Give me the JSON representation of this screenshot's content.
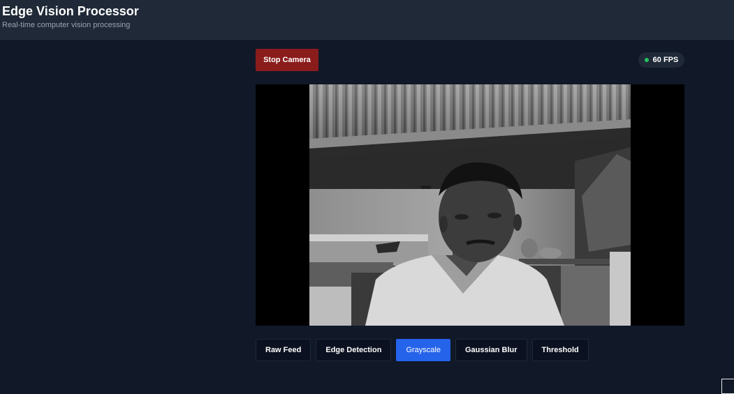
{
  "header": {
    "title": "Edge Vision Processor",
    "subtitle": "Real-time computer vision processing"
  },
  "controls": {
    "stop_label": "Stop Camera",
    "fps_label": "60 FPS",
    "fps_status_color": "#22c55e",
    "stop_color": "#8b1c1c"
  },
  "video": {
    "filter_applied": "grayscale",
    "icon": "camera-feed-image"
  },
  "filters": [
    {
      "label": "Raw Feed",
      "active": false
    },
    {
      "label": "Edge Detection",
      "active": false
    },
    {
      "label": "Grayscale",
      "active": true
    },
    {
      "label": "Gaussian Blur",
      "active": false
    },
    {
      "label": "Threshold",
      "active": false
    }
  ],
  "colors": {
    "background": "#111827",
    "header": "#1f2937",
    "accent": "#2563eb"
  }
}
